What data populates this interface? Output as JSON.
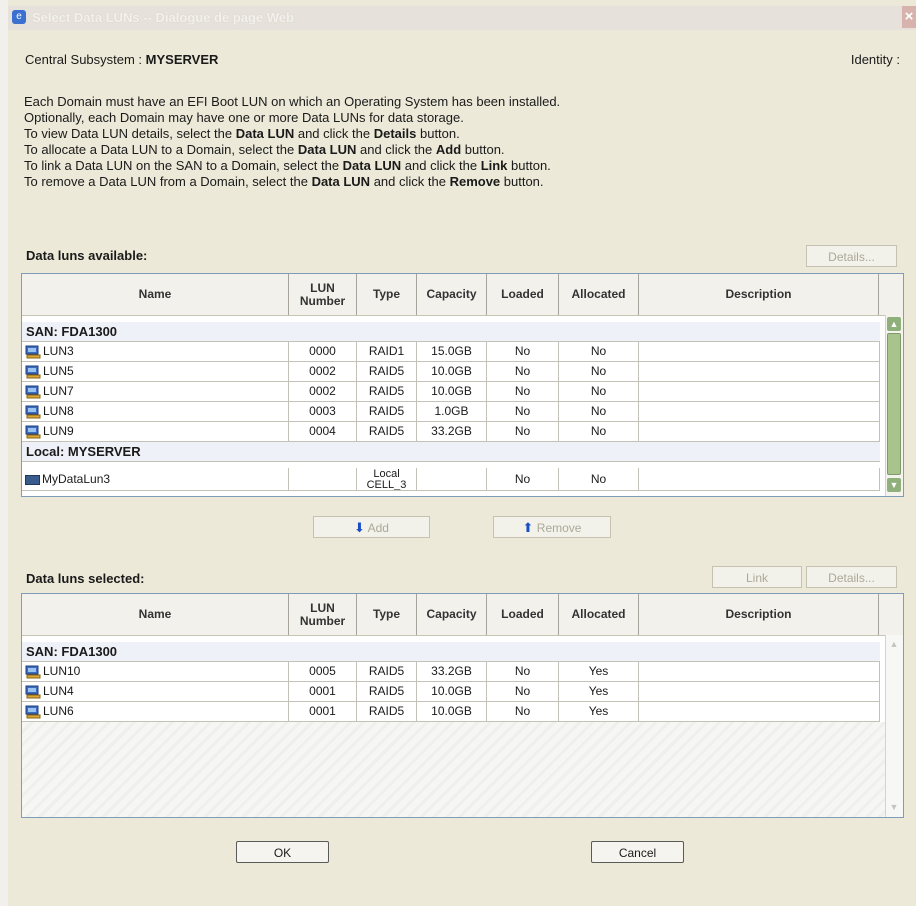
{
  "window": {
    "title": "Select Data LUNs -- Dialogue de page Web",
    "close_glyph": "×"
  },
  "header": {
    "subsystem_label": "Central Subsystem :",
    "subsystem_value": "MYSERVER",
    "identity_label": "Identity :"
  },
  "intro": {
    "line1": "Each Domain must have an EFI Boot LUN on which an Operating System has been installed.",
    "line2": "Optionally, each Domain may have one or more Data LUNs for data storage.",
    "line3_a": "To view Data LUN details, select the ",
    "line3_b": "Data LUN",
    "line3_c": " and click the ",
    "line3_d": "Details",
    "line3_e": " button.",
    "line4_a": "To allocate a Data LUN to a Domain, select the ",
    "line4_b": "Data LUN",
    "line4_c": " and click the ",
    "line4_d": "Add",
    "line4_e": " button.",
    "line5_a": "To link a Data LUN on the SAN to a Domain, select the ",
    "line5_b": "Data LUN",
    "line5_c": " and click the ",
    "line5_d": "Link",
    "line5_e": " button.",
    "line6_a": "To remove a Data LUN from a Domain, select the ",
    "line6_b": "Data LUN",
    "line6_c": " and click the ",
    "line6_d": "Remove",
    "line6_e": " button."
  },
  "available": {
    "title": "Data luns available:",
    "details_label": "Details...",
    "columns": [
      "Name",
      "LUN Number",
      "Type",
      "Capacity",
      "Loaded",
      "Allocated",
      "Description"
    ],
    "group1": "SAN: FDA1300",
    "rows": [
      {
        "name": "LUN3",
        "number": "0000",
        "type": "RAID1",
        "capacity": "15.0GB",
        "loaded": "No",
        "allocated": "No",
        "description": ""
      },
      {
        "name": "LUN5",
        "number": "0002",
        "type": "RAID5",
        "capacity": "10.0GB",
        "loaded": "No",
        "allocated": "No",
        "description": ""
      },
      {
        "name": "LUN7",
        "number": "0002",
        "type": "RAID5",
        "capacity": "10.0GB",
        "loaded": "No",
        "allocated": "No",
        "description": ""
      },
      {
        "name": "LUN8",
        "number": "0003",
        "type": "RAID5",
        "capacity": "1.0GB",
        "loaded": "No",
        "allocated": "No",
        "description": ""
      },
      {
        "name": "LUN9",
        "number": "0004",
        "type": "RAID5",
        "capacity": "33.2GB",
        "loaded": "No",
        "allocated": "No",
        "description": ""
      }
    ],
    "group2": "Local: MYSERVER",
    "local_row": {
      "name": "MyDataLun3",
      "number": "",
      "type_line1": "Local",
      "type_line2": "CELL_3",
      "capacity": "",
      "loaded": "No",
      "allocated": "No",
      "description": ""
    }
  },
  "actions": {
    "add_label": "Add",
    "remove_label": "Remove"
  },
  "selected": {
    "title": "Data luns selected:",
    "link_label": "Link",
    "details_label": "Details...",
    "columns": [
      "Name",
      "LUN Number",
      "Type",
      "Capacity",
      "Loaded",
      "Allocated",
      "Description"
    ],
    "group1": "SAN: FDA1300",
    "rows": [
      {
        "name": "LUN10",
        "number": "0005",
        "type": "RAID5",
        "capacity": "33.2GB",
        "loaded": "No",
        "allocated": "Yes",
        "description": ""
      },
      {
        "name": "LUN4",
        "number": "0001",
        "type": "RAID5",
        "capacity": "10.0GB",
        "loaded": "No",
        "allocated": "Yes",
        "description": ""
      },
      {
        "name": "LUN6",
        "number": "0001",
        "type": "RAID5",
        "capacity": "10.0GB",
        "loaded": "No",
        "allocated": "Yes",
        "description": ""
      }
    ]
  },
  "footer": {
    "ok_label": "OK",
    "cancel_label": "Cancel"
  }
}
